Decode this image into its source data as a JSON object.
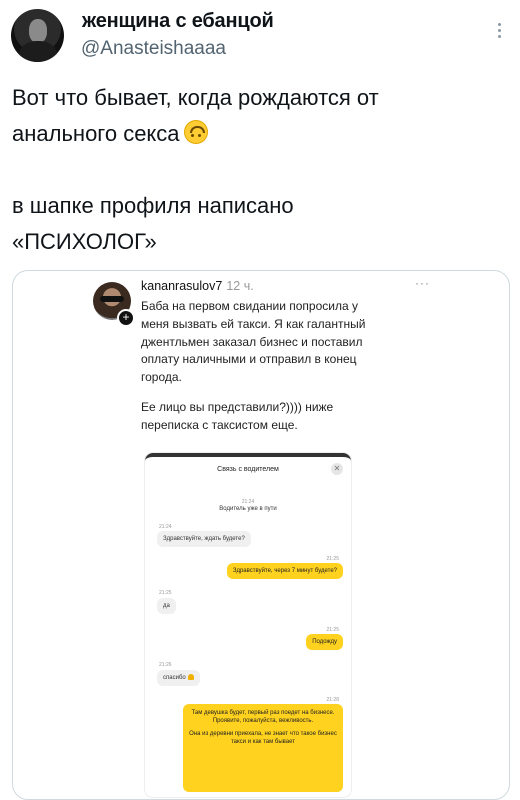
{
  "author": {
    "display_name": "женщина с ебанцой",
    "handle": "@Anasteishaaaa"
  },
  "tweet": {
    "line1": "Вот что бывает, когда рождаются от",
    "line2": "анального секса",
    "line3": "в шапке профиля написано",
    "line4": "«ПСИХОЛОГ»",
    "emoji": "upside-down-face-icon"
  },
  "screenshot_post": {
    "username": "kananrasulov7",
    "time_ago": "12 ч.",
    "text_lines": [
      "Баба на первом свидании попросила у",
      "меня вызвать ей такси. Я как галантный",
      "джентльмен заказал бизнес и поставил",
      "оплату наличными и отправил в конец",
      "города."
    ],
    "text2_lines": [
      "Ее лицо вы представили?)))) ниже",
      "переписка с таксистом еще."
    ]
  },
  "chat": {
    "title": "Связь с водителем",
    "system_time": "21:24",
    "system_msg": "Водитель уже в пути",
    "messages": [
      {
        "from": "driver",
        "time": "21:24",
        "text": "Здравствуйте, ждать будете?"
      },
      {
        "from": "user",
        "time": "21:25",
        "text": "Здравствуйте, через 7 минут будете?"
      },
      {
        "from": "driver",
        "time": "21:25",
        "text": "да"
      },
      {
        "from": "user",
        "time": "21:25",
        "text": "Подожду"
      },
      {
        "from": "driver",
        "time": "21:26",
        "text": "спасибо"
      },
      {
        "from": "user",
        "time": "21:28",
        "text": "Там девушка будет, первый раз поедет на бизнесе. Проявите, пожалуйста, вежливость.",
        "text2": "Она из деревни приехала, не знает что такое бизнес такси и как там бывает"
      }
    ]
  },
  "colors": {
    "handle_gray": "#536471",
    "driver_bubble": "#f0f0f0",
    "user_bubble": "#ffd21f"
  }
}
